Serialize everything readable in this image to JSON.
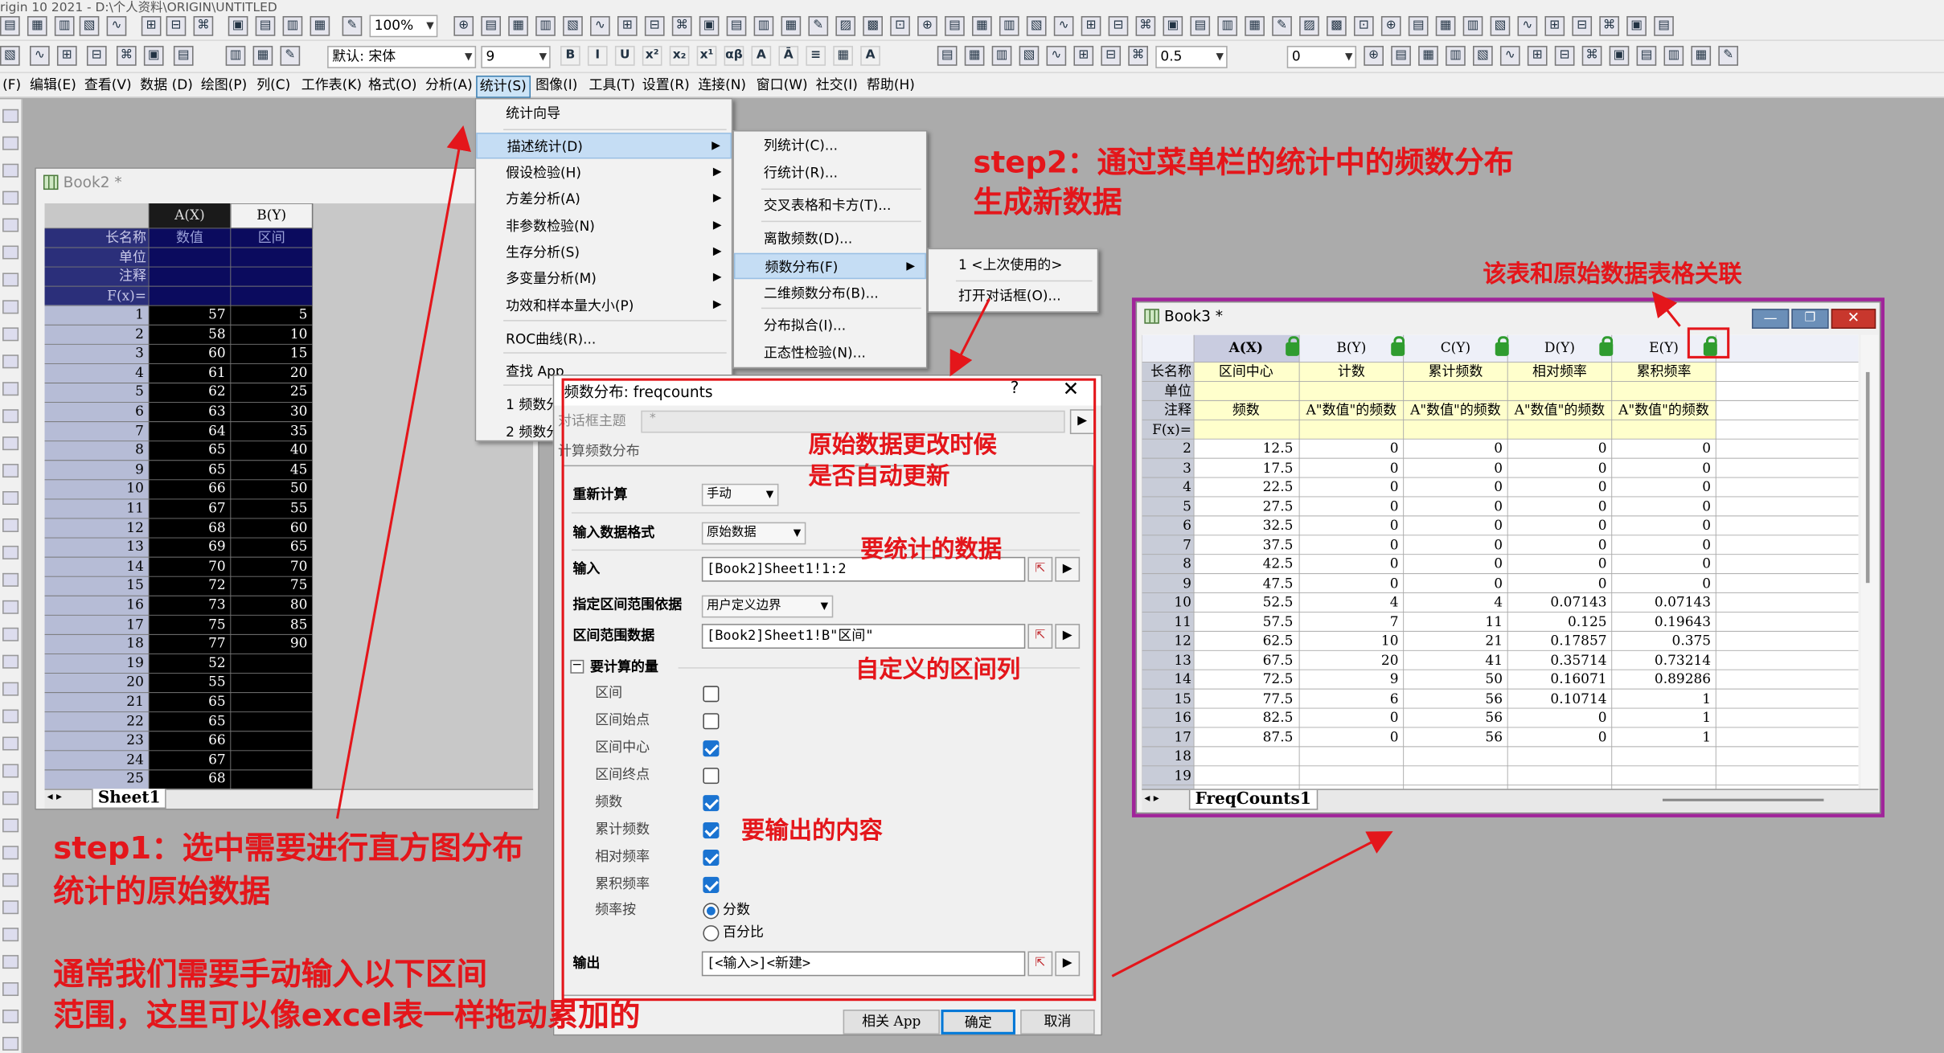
{
  "app": {
    "title": "rigin 10 2021 - D:\\个人资料\\ORIGIN\\UNTITLED"
  },
  "toolbar": {
    "zoom": "100%",
    "font_name": "默认: 宋体",
    "font_size": "9",
    "line_width": "0.5",
    "field_zero": "0"
  },
  "menubar": [
    "(F)",
    "编辑(E)",
    "查看(V)",
    "数据 (D)",
    "绘图(P)",
    "列(C)",
    "工作表(K)",
    "格式(O)",
    "分析(A)",
    "统计(S)",
    "图像(I)",
    "工具(T)",
    "设置(R)",
    "连接(N)",
    "窗口(W)",
    "社交(I)",
    "帮助(H)"
  ],
  "book2": {
    "title": "Book2 *",
    "col_headers": [
      "A(X)",
      "B(Y)"
    ],
    "meta_labels": [
      "长名称",
      "单位",
      "注释",
      "F(x)="
    ],
    "long_names": [
      "数值",
      "区间"
    ],
    "row_numbers": [
      "1",
      "2",
      "3",
      "4",
      "5",
      "6",
      "7",
      "8",
      "9",
      "10",
      "11",
      "12",
      "13",
      "14",
      "15",
      "16",
      "17",
      "18",
      "19",
      "20",
      "21",
      "22",
      "23",
      "24",
      "25"
    ],
    "col_a": [
      "57",
      "58",
      "60",
      "61",
      "62",
      "63",
      "64",
      "65",
      "65",
      "66",
      "67",
      "68",
      "69",
      "70",
      "72",
      "73",
      "75",
      "77",
      "52",
      "55",
      "65",
      "65",
      "66",
      "67",
      "68"
    ],
    "col_b": [
      "5",
      "10",
      "15",
      "20",
      "25",
      "30",
      "35",
      "40",
      "45",
      "50",
      "55",
      "60",
      "65",
      "70",
      "75",
      "80",
      "85",
      "90",
      "",
      "",
      "",
      "",
      "",
      "",
      ""
    ],
    "sheet_tab": "Sheet1"
  },
  "stats_menu": {
    "items": [
      "统计向导",
      "描述统计(D)",
      "假设检验(H)",
      "方差分析(A)",
      "非参数检验(N)",
      "生存分析(S)",
      "多变量分析(M)",
      "功效和样本量大小(P)",
      "ROC曲线(R)...",
      "查找 App",
      "1 频数分",
      "2 频数分"
    ]
  },
  "desc_submenu": {
    "items": [
      "列统计(C)...",
      "行统计(R)...",
      "交叉表格和卡方(T)...",
      "离散频数(D)...",
      "频数分布(F)",
      "二维频数分布(B)...",
      "分布拟合(I)...",
      "正态性检验(N)..."
    ]
  },
  "freq_submenu": {
    "items": [
      "1 <上次使用的>",
      "打开对话框(O)..."
    ]
  },
  "dialog": {
    "title": "频数分布: freqcounts",
    "help": "?",
    "theme_label": "对话框主题",
    "theme_value": "*",
    "desc": "计算频数分布",
    "recalc_label": "重新计算",
    "recalc_value": "手动",
    "format_label": "输入数据格式",
    "format_value": "原始数据",
    "input_label": "输入",
    "input_value": "[Book2]Sheet1!1:2",
    "bins_by_label": "指定区间范围依据",
    "bins_by_value": "用户定义边界",
    "bins_data_label": "区间范围数据",
    "bins_data_value": "[Book2]Sheet1!B\"区间\"",
    "quantities_label": "要计算的量",
    "options": [
      {
        "label": "区间",
        "checked": false
      },
      {
        "label": "区间始点",
        "checked": false
      },
      {
        "label": "区间中心",
        "checked": true
      },
      {
        "label": "区间终点",
        "checked": false
      },
      {
        "label": "频数",
        "checked": true
      },
      {
        "label": "累计频数",
        "checked": true
      },
      {
        "label": "相对频率",
        "checked": true
      },
      {
        "label": "累积频率",
        "checked": true
      }
    ],
    "freq_by_label": "频率按",
    "freq_by_opt1": "分数",
    "freq_by_opt2": "百分比",
    "output_label": "输出",
    "output_value": "[<输入>]<新建>",
    "btn_app": "相关 App",
    "btn_ok": "确定",
    "btn_cancel": "取消"
  },
  "book3": {
    "title": "Book3 *",
    "col_headers": [
      "A(X)",
      "B(Y)",
      "C(Y)",
      "D(Y)",
      "E(Y)"
    ],
    "meta_labels": [
      "长名称",
      "单位",
      "注释",
      "F(x)="
    ],
    "long_names": [
      "区间中心",
      "计数",
      "累计频数",
      "相对频率",
      "累积频率"
    ],
    "comments": [
      "频数",
      "A\"数值\"的频数",
      "A\"数值\"的频数",
      "A\"数值\"的频数",
      "A\"数值\"的频数"
    ],
    "rows": [
      [
        "2",
        "12.5",
        "0",
        "0",
        "0",
        "0"
      ],
      [
        "3",
        "17.5",
        "0",
        "0",
        "0",
        "0"
      ],
      [
        "4",
        "22.5",
        "0",
        "0",
        "0",
        "0"
      ],
      [
        "5",
        "27.5",
        "0",
        "0",
        "0",
        "0"
      ],
      [
        "6",
        "32.5",
        "0",
        "0",
        "0",
        "0"
      ],
      [
        "7",
        "37.5",
        "0",
        "0",
        "0",
        "0"
      ],
      [
        "8",
        "42.5",
        "0",
        "0",
        "0",
        "0"
      ],
      [
        "9",
        "47.5",
        "0",
        "0",
        "0",
        "0"
      ],
      [
        "10",
        "52.5",
        "4",
        "4",
        "0.07143",
        "0.07143"
      ],
      [
        "11",
        "57.5",
        "7",
        "11",
        "0.125",
        "0.19643"
      ],
      [
        "12",
        "62.5",
        "10",
        "21",
        "0.17857",
        "0.375"
      ],
      [
        "13",
        "67.5",
        "20",
        "41",
        "0.35714",
        "0.73214"
      ],
      [
        "14",
        "72.5",
        "9",
        "50",
        "0.16071",
        "0.89286"
      ],
      [
        "15",
        "77.5",
        "6",
        "56",
        "0.10714",
        "1"
      ],
      [
        "16",
        "82.5",
        "0",
        "56",
        "0",
        "1"
      ],
      [
        "17",
        "87.5",
        "0",
        "56",
        "0",
        "1"
      ],
      [
        "18",
        "",
        "",
        "",
        "",
        ""
      ],
      [
        "19",
        "",
        "",
        "",
        "",
        ""
      ]
    ],
    "sheet_tab": "FreqCounts1"
  },
  "annotations": {
    "step1_a": "step1：选中需要进行直方图分布",
    "step1_b": "统计的原始数据",
    "note_a": "通常我们需要手动输入以下区间",
    "note_b": "范围，这里可以像excel表一样拖动累加的",
    "step2_a": "step2：通过菜单栏的统计中的频数分布",
    "step2_b": "生成新数据",
    "linked": "该表和原始数据表格关联",
    "auto_update_a": "原始数据更改时候",
    "auto_update_b": "是否自动更新",
    "data_to_stat": "要统计的数据",
    "custom_bins": "自定义的区间列",
    "output_content": "要输出的内容"
  },
  "colors": {
    "annotation": "#e4161b",
    "book3_frame": "#a0249a",
    "selection_dark": "#000000",
    "highlight": "#c5ddf4",
    "check_blue": "#1a73d1"
  }
}
